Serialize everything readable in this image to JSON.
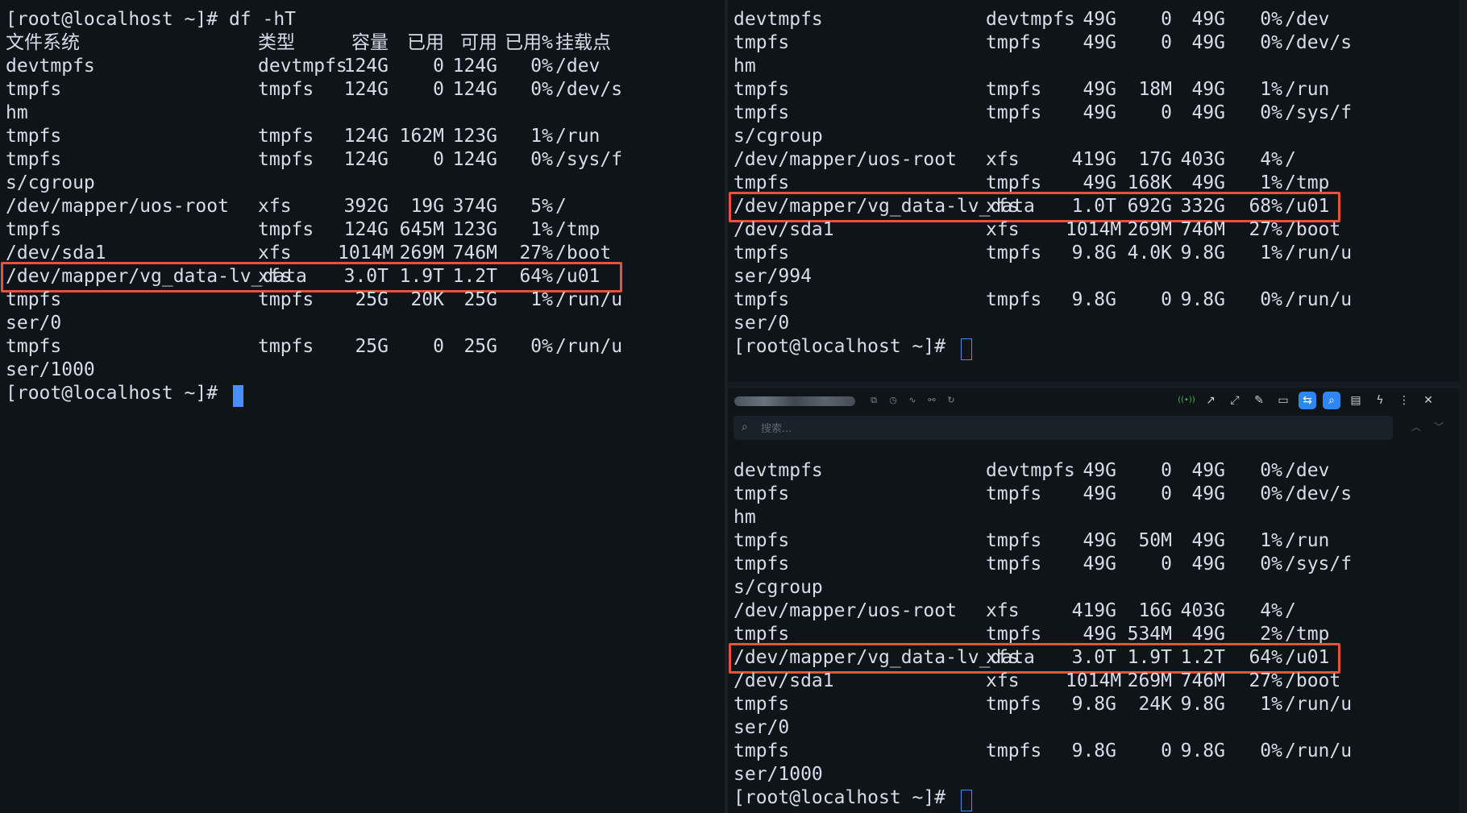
{
  "left_pane": {
    "lines": [
      {
        "type": "raw",
        "text": "[root@localhost ~]# df -hT"
      },
      {
        "type": "row",
        "cells": [
          "文件系统",
          "类型",
          "容量",
          "已用",
          "可用",
          "已用%",
          "挂载点"
        ]
      },
      {
        "type": "row",
        "cells": [
          "devtmpfs",
          "devtmpfs",
          "124G",
          "0",
          "124G",
          "0%",
          "/dev"
        ]
      },
      {
        "type": "row",
        "cells": [
          "tmpfs",
          "tmpfs",
          "124G",
          "0",
          "124G",
          "0%",
          "/dev/s"
        ]
      },
      {
        "type": "raw",
        "text": "hm"
      },
      {
        "type": "row",
        "cells": [
          "tmpfs",
          "tmpfs",
          "124G",
          "162M",
          "123G",
          "1%",
          "/run"
        ]
      },
      {
        "type": "row",
        "cells": [
          "tmpfs",
          "tmpfs",
          "124G",
          "0",
          "124G",
          "0%",
          "/sys/f"
        ]
      },
      {
        "type": "raw",
        "text": "s/cgroup"
      },
      {
        "type": "row",
        "cells": [
          "/dev/mapper/uos-root",
          "xfs",
          "392G",
          "19G",
          "374G",
          "5%",
          "/"
        ]
      },
      {
        "type": "row",
        "cells": [
          "tmpfs",
          "tmpfs",
          "124G",
          "645M",
          "123G",
          "1%",
          "/tmp"
        ]
      },
      {
        "type": "row",
        "cells": [
          "/dev/sda1",
          "xfs",
          "1014M",
          "269M",
          "746M",
          "27%",
          "/boot"
        ]
      },
      {
        "type": "row",
        "highlight": true,
        "cells": [
          "/dev/mapper/vg_data-lv_data",
          "xfs",
          "3.0T",
          "1.9T",
          "1.2T",
          "64%",
          "/u01"
        ]
      },
      {
        "type": "row",
        "cells": [
          "tmpfs",
          "tmpfs",
          "25G",
          "20K",
          "25G",
          "1%",
          "/run/u"
        ]
      },
      {
        "type": "raw",
        "text": "ser/0"
      },
      {
        "type": "row",
        "cells": [
          "tmpfs",
          "tmpfs",
          "25G",
          "0",
          "25G",
          "0%",
          "/run/u"
        ]
      },
      {
        "type": "raw",
        "text": "ser/1000"
      },
      {
        "type": "prompt",
        "text": "[root@localhost ~]# ",
        "cursor": "filled"
      }
    ]
  },
  "top_right_pane": {
    "lines": [
      {
        "type": "row",
        "cells": [
          "devtmpfs",
          "devtmpfs",
          "49G",
          "0",
          "49G",
          "0%",
          "/dev"
        ]
      },
      {
        "type": "row",
        "cells": [
          "tmpfs",
          "tmpfs",
          "49G",
          "0",
          "49G",
          "0%",
          "/dev/s"
        ]
      },
      {
        "type": "raw",
        "text": "hm"
      },
      {
        "type": "row",
        "cells": [
          "tmpfs",
          "tmpfs",
          "49G",
          "18M",
          "49G",
          "1%",
          "/run"
        ]
      },
      {
        "type": "row",
        "cells": [
          "tmpfs",
          "tmpfs",
          "49G",
          "0",
          "49G",
          "0%",
          "/sys/f"
        ]
      },
      {
        "type": "raw",
        "text": "s/cgroup"
      },
      {
        "type": "row",
        "cells": [
          "/dev/mapper/uos-root",
          "xfs",
          "419G",
          "17G",
          "403G",
          "4%",
          "/"
        ]
      },
      {
        "type": "row",
        "cells": [
          "tmpfs",
          "tmpfs",
          "49G",
          "168K",
          "49G",
          "1%",
          "/tmp"
        ]
      },
      {
        "type": "row",
        "highlight": true,
        "cells": [
          "/dev/mapper/vg_data-lv_data",
          "xfs",
          "1.0T",
          "692G",
          "332G",
          "68%",
          "/u01"
        ]
      },
      {
        "type": "row",
        "cells": [
          "/dev/sda1",
          "xfs",
          "1014M",
          "269M",
          "746M",
          "27%",
          "/boot"
        ]
      },
      {
        "type": "row",
        "cells": [
          "tmpfs",
          "tmpfs",
          "9.8G",
          "4.0K",
          "9.8G",
          "1%",
          "/run/u"
        ]
      },
      {
        "type": "raw",
        "text": "ser/994"
      },
      {
        "type": "row",
        "cells": [
          "tmpfs",
          "tmpfs",
          "9.8G",
          "0",
          "9.8G",
          "0%",
          "/run/u"
        ]
      },
      {
        "type": "raw",
        "text": "ser/0"
      },
      {
        "type": "prompt",
        "text": "[root@localhost ~]# ",
        "cursor": "hollow"
      }
    ]
  },
  "toolbar": {
    "icons": [
      "copy-icon",
      "clock-icon",
      "activity-icon",
      "link-icon",
      "refresh-icon",
      "broadcast-icon",
      "external-link-icon",
      "expand-icon",
      "pen-icon",
      "folder-icon",
      "split-icon",
      "search-icon",
      "file-icon",
      "lightning-icon",
      "more-vertical-icon",
      "close-icon"
    ],
    "glyphs": [
      "⧉",
      "◷",
      "∿",
      "⚯",
      "↻",
      "((•))",
      "↗",
      "⤢",
      "✎",
      "▭",
      "⇆",
      "⌕",
      "▤",
      "ϟ",
      "⋮",
      "✕"
    ]
  },
  "search": {
    "placeholder": "搜索...",
    "value": "",
    "prev_label": "︿",
    "next_label": "﹀"
  },
  "bottom_right_pane": {
    "lines": [
      {
        "type": "row",
        "cells": [
          "devtmpfs",
          "devtmpfs",
          "49G",
          "0",
          "49G",
          "0%",
          "/dev"
        ]
      },
      {
        "type": "row",
        "cells": [
          "tmpfs",
          "tmpfs",
          "49G",
          "0",
          "49G",
          "0%",
          "/dev/s"
        ]
      },
      {
        "type": "raw",
        "text": "hm"
      },
      {
        "type": "row",
        "cells": [
          "tmpfs",
          "tmpfs",
          "49G",
          "50M",
          "49G",
          "1%",
          "/run"
        ]
      },
      {
        "type": "row",
        "cells": [
          "tmpfs",
          "tmpfs",
          "49G",
          "0",
          "49G",
          "0%",
          "/sys/f"
        ]
      },
      {
        "type": "raw",
        "text": "s/cgroup"
      },
      {
        "type": "row",
        "cells": [
          "/dev/mapper/uos-root",
          "xfs",
          "419G",
          "16G",
          "403G",
          "4%",
          "/"
        ]
      },
      {
        "type": "row",
        "cells": [
          "tmpfs",
          "tmpfs",
          "49G",
          "534M",
          "49G",
          "2%",
          "/tmp"
        ]
      },
      {
        "type": "row",
        "highlight": true,
        "cells": [
          "/dev/mapper/vg_data-lv_data",
          "xfs",
          "3.0T",
          "1.9T",
          "1.2T",
          "64%",
          "/u01"
        ]
      },
      {
        "type": "row",
        "cells": [
          "/dev/sda1",
          "xfs",
          "1014M",
          "269M",
          "746M",
          "27%",
          "/boot"
        ]
      },
      {
        "type": "row",
        "cells": [
          "tmpfs",
          "tmpfs",
          "9.8G",
          "24K",
          "9.8G",
          "1%",
          "/run/u"
        ]
      },
      {
        "type": "raw",
        "text": "ser/0"
      },
      {
        "type": "row",
        "cells": [
          "tmpfs",
          "tmpfs",
          "9.8G",
          "0",
          "9.8G",
          "0%",
          "/run/u"
        ]
      },
      {
        "type": "raw",
        "text": "ser/1000"
      },
      {
        "type": "prompt",
        "text": "[root@localhost ~]# ",
        "cursor": "hollow"
      }
    ]
  },
  "colors": {
    "background": "#0f1419",
    "text": "#d6dde6",
    "highlight_border": "#e5533d",
    "cursor": "#4c8ef7",
    "active_button": "#2f86f0"
  }
}
